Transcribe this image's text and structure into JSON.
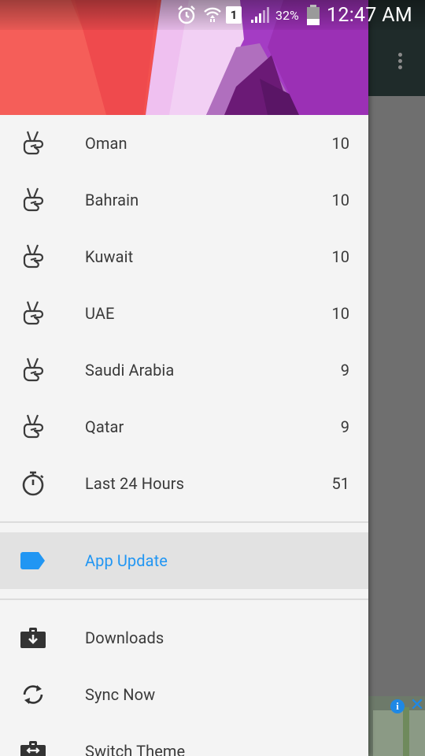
{
  "status_bar": {
    "sim_slot": "1",
    "battery_percent": "32%",
    "time": "12:47 AM"
  },
  "drawer": {
    "countries": [
      {
        "label": "Oman",
        "count": "10",
        "icon": "victory-hand-icon"
      },
      {
        "label": "Bahrain",
        "count": "10",
        "icon": "victory-hand-icon"
      },
      {
        "label": "Kuwait",
        "count": "10",
        "icon": "victory-hand-icon"
      },
      {
        "label": "UAE",
        "count": "10",
        "icon": "victory-hand-icon"
      },
      {
        "label": "Saudi Arabia",
        "count": "9",
        "icon": "victory-hand-icon"
      },
      {
        "label": "Qatar",
        "count": "9",
        "icon": "victory-hand-icon"
      }
    ],
    "last_24": {
      "label": "Last 24 Hours",
      "count": "51",
      "icon": "stopwatch-icon"
    },
    "app_update": {
      "label": "App Update",
      "icon": "label-tag-icon"
    },
    "downloads": {
      "label": "Downloads",
      "icon": "briefcase-download-icon"
    },
    "sync_now": {
      "label": "Sync Now",
      "icon": "sync-icon"
    },
    "switch_theme": {
      "label": "Switch Theme",
      "icon": "briefcase-swap-icon"
    }
  },
  "colors": {
    "accent": "#2196f3",
    "drawer_bg": "#f4f4f4",
    "active_row_bg": "#e2e2e2",
    "header_purple": "#9b33b8",
    "header_red": "#f44336"
  }
}
